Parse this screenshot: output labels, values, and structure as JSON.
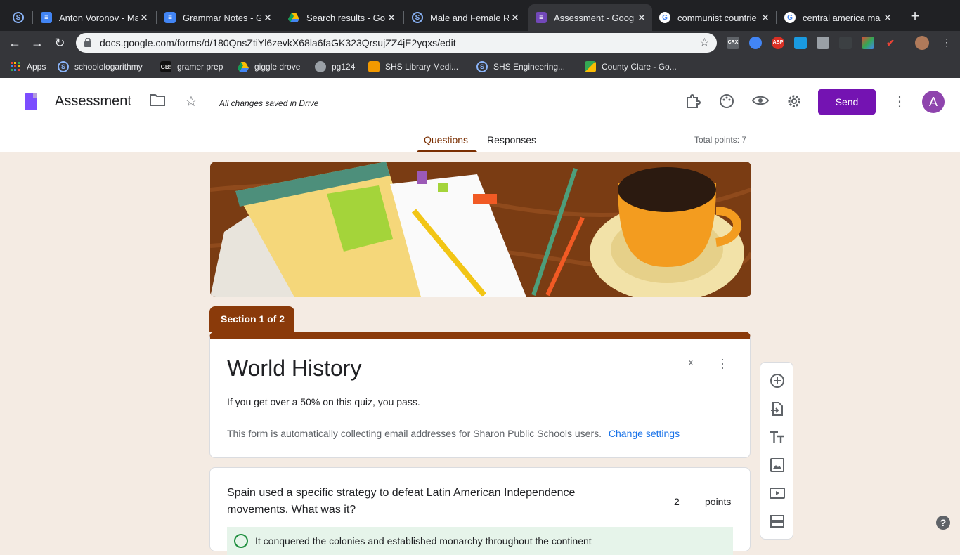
{
  "browser": {
    "tabs": [
      {
        "title": "Anton Voronov - Ma",
        "icon": "docs-icon"
      },
      {
        "title": "Grammar Notes - G",
        "icon": "docs-icon"
      },
      {
        "title": "Search results - Go",
        "icon": "drive-icon"
      },
      {
        "title": "Male and Female Re",
        "icon": "schoology-icon"
      },
      {
        "title": "Assessment - Goog",
        "icon": "forms-icon"
      },
      {
        "title": "communist countrie",
        "icon": "google-icon"
      },
      {
        "title": "central america ma",
        "icon": "google-icon"
      }
    ],
    "new_tab": "+",
    "url": "docs.google.com/forms/d/180QnsZtiYl6zevkX68la6faGK323QrsujZZ4jE2yqxs/edit",
    "extensions": [
      "CRX",
      "ABP"
    ],
    "bookmarks": [
      {
        "label": "Apps"
      },
      {
        "label": "schoolologarithmy"
      },
      {
        "label": "gramer prep",
        "badge": "GB!"
      },
      {
        "label": "giggle drove"
      },
      {
        "label": "pg124"
      },
      {
        "label": "SHS Library Medi..."
      },
      {
        "label": "SHS Engineering..."
      },
      {
        "label": "County Clare - Go..."
      }
    ],
    "schoology_letter": "S"
  },
  "form_header": {
    "title": "Assessment",
    "saved_status": "All changes saved in Drive",
    "send_label": "Send",
    "avatar_letter": "A",
    "tabs": [
      "Questions",
      "Responses"
    ],
    "total_points": "Total points: 7"
  },
  "section": {
    "label": "Section 1 of 2",
    "title": "World History",
    "description": "If you get over a 50% on this quiz, you pass.",
    "email_note": "This form is automatically collecting email addresses for Sharon Public Schools users.",
    "change_settings": "Change settings"
  },
  "question": {
    "text": "Spain used a specific strategy to defeat Latin American Independence movements. What was it?",
    "points_value": "2",
    "points_label": "points",
    "answer_preview": "It conquered the colonies and established monarchy throughout the continent"
  },
  "help_label": "?",
  "colors": {
    "accent": "#7413b2",
    "theme": "#8a3a0a",
    "background": "#f4ebe3"
  }
}
